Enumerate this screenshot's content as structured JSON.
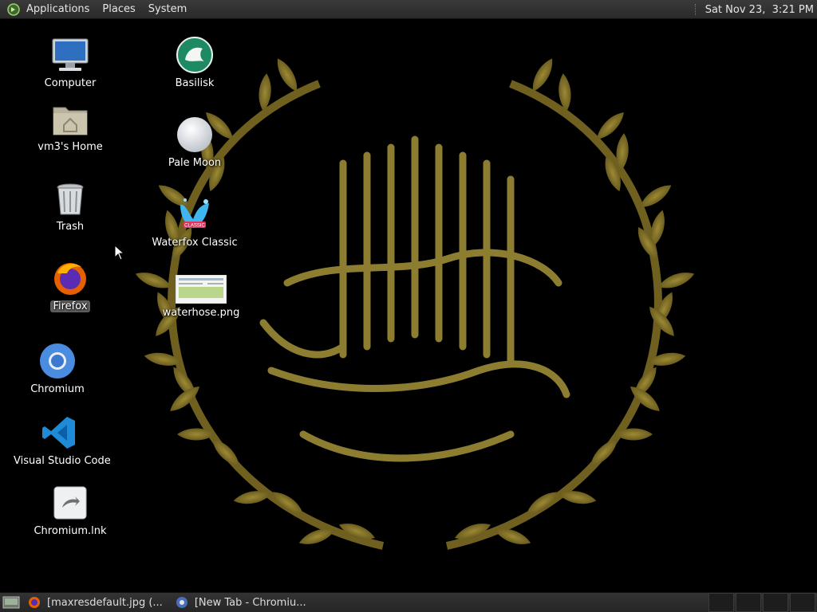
{
  "top_panel": {
    "menus": [
      "Applications",
      "Places",
      "System"
    ],
    "clock": "Sat Nov 23,  3:21 PM"
  },
  "desktop_icons": {
    "computer": "Computer",
    "home": "vm3's Home",
    "trash": "Trash",
    "firefox": "Firefox",
    "chromium": "Chromium",
    "vscode": "Visual Studio Code",
    "chromium_lnk": "Chromium.lnk",
    "basilisk": "Basilisk",
    "palemoon": "Pale Moon",
    "waterfox": "Waterfox Classic",
    "waterhose": "waterhose.png"
  },
  "icon_badges": {
    "waterfox": "CLASSIC"
  },
  "taskbar": {
    "tasks": [
      "[maxresdefault.jpg (...",
      "[New Tab - Chromiu..."
    ]
  },
  "colors": {
    "panel": "#2e2e2e",
    "wallpaper_gold": "#8a7a2a",
    "selection": "#5f5f5f"
  }
}
